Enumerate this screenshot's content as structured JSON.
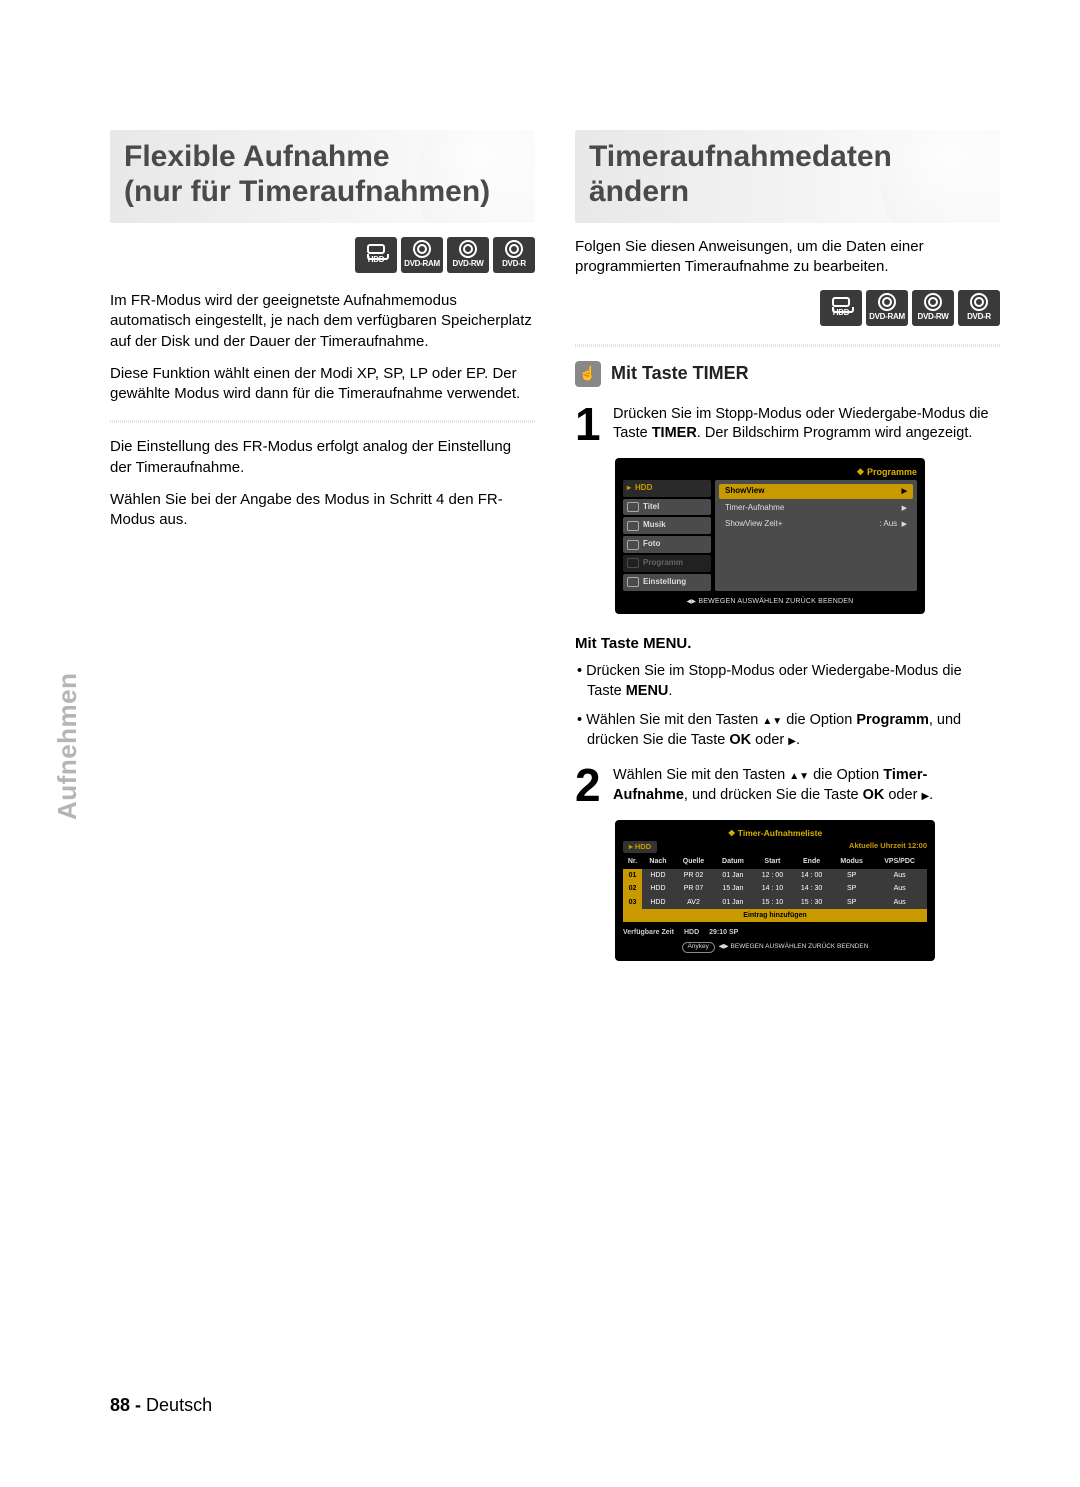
{
  "left": {
    "heading_line1": "Flexible Aufnahme",
    "heading_line2": "(nur für Timeraufnahmen)",
    "discs": [
      "HDD",
      "DVD-RAM",
      "DVD-RW",
      "DVD-R"
    ],
    "p1": "Im FR-Modus wird der geeignetste Aufnahmemodus automatisch eingestellt, je nach dem verfügbaren Speicherplatz auf der Disk und der Dauer der Timeraufnahme.",
    "p2": "Diese Funktion wählt einen der Modi XP, SP, LP oder EP. Der gewählte Modus wird dann für die Timeraufnahme verwendet.",
    "p3": "Die Einstellung des FR-Modus erfolgt analog der Einstellung der Timeraufnahme.",
    "p4": "Wählen Sie bei der Angabe des Modus in Schritt 4 den FR-Modus aus."
  },
  "right": {
    "heading_line1": "Timeraufnahmedaten",
    "heading_line2": "ändern",
    "intro": "Folgen Sie diesen Anweisungen, um die  Daten einer programmierten Timeraufnahme zu bearbeiten.",
    "discs": [
      "HDD",
      "DVD-RAM",
      "DVD-RW",
      "DVD-R"
    ],
    "section_title": "Mit Taste TIMER",
    "step1_pre": "Drücken Sie im Stopp-Modus oder Wiedergabe-Modus die Taste ",
    "step1_bold": "TIMER",
    "step1_post": ". Der Bildschirm Programm wird angezeigt.",
    "menu_h": "Mit Taste MENU.",
    "menu_b1_pre": "Drücken Sie im Stopp-Modus oder Wiedergabe-Modus die Taste ",
    "menu_b1_bold": "MENU",
    "menu_b1_post": ".",
    "menu_b2_pre": "Wählen Sie mit den Tasten ",
    "menu_b2_mid": " die Option ",
    "menu_b2_bold": "Programm",
    "menu_b2_post": ", und drücken Sie die Taste ",
    "menu_b2_bold2": "OK",
    "menu_b2_post2": " oder ",
    "menu_b2_post3": ".",
    "step2_pre": "Wählen Sie mit den Tasten ",
    "step2_mid": " die Option ",
    "step2_bold": "Timer-Aufnahme",
    "step2_post": ", und drücken Sie die Taste ",
    "step2_bold2": "OK",
    "step2_post2": " oder ",
    "step2_post3": "."
  },
  "osd1": {
    "title": "Programme",
    "top_tab": "HDD",
    "left_tabs": [
      "Titel",
      "Musik",
      "Foto",
      "Programm",
      "Einstellung"
    ],
    "right_items": [
      {
        "label": "ShowView",
        "sel": true
      },
      {
        "label": "Timer-Aufnahme",
        "sel": false
      },
      {
        "label": "ShowView Zeit+",
        "value": ": Aus",
        "sel": false
      }
    ],
    "footer": "BEWEGEN    AUSWÄHLEN    ZURÜCK    BEENDEN"
  },
  "osd2": {
    "title": "Timer-Aufnahmeliste",
    "top_tab": "HDD",
    "clock": "Aktuelle Uhrzeit 12:00",
    "cols": [
      "Nr.",
      "Nach",
      "Quelle",
      "Datum",
      "Start",
      "Ende",
      "Modus",
      "VPS/PDC"
    ],
    "rows": [
      [
        "01",
        "HDD",
        "PR 02",
        "01 Jan",
        "12 : 00",
        "14 : 00",
        "SP",
        "Aus"
      ],
      [
        "02",
        "HDD",
        "PR 07",
        "15 Jan",
        "14 : 10",
        "14 : 30",
        "SP",
        "Aus"
      ],
      [
        "03",
        "HDD",
        "AV2",
        "01 Jan",
        "15 : 10",
        "15 : 30",
        "SP",
        "Aus"
      ]
    ],
    "addrow": "Eintrag hinzufügen",
    "avail_label": "Verfügbare Zeit",
    "avail_hdd": "HDD",
    "avail_time": "29:10 SP",
    "anykey": "Anykey",
    "footer": "BEWEGEN    AUSWÄHLEN    ZURÜCK    BEENDEN"
  },
  "side_tab": "Aufnehmen",
  "footer_page": "88 -",
  "footer_lang": "Deutsch"
}
